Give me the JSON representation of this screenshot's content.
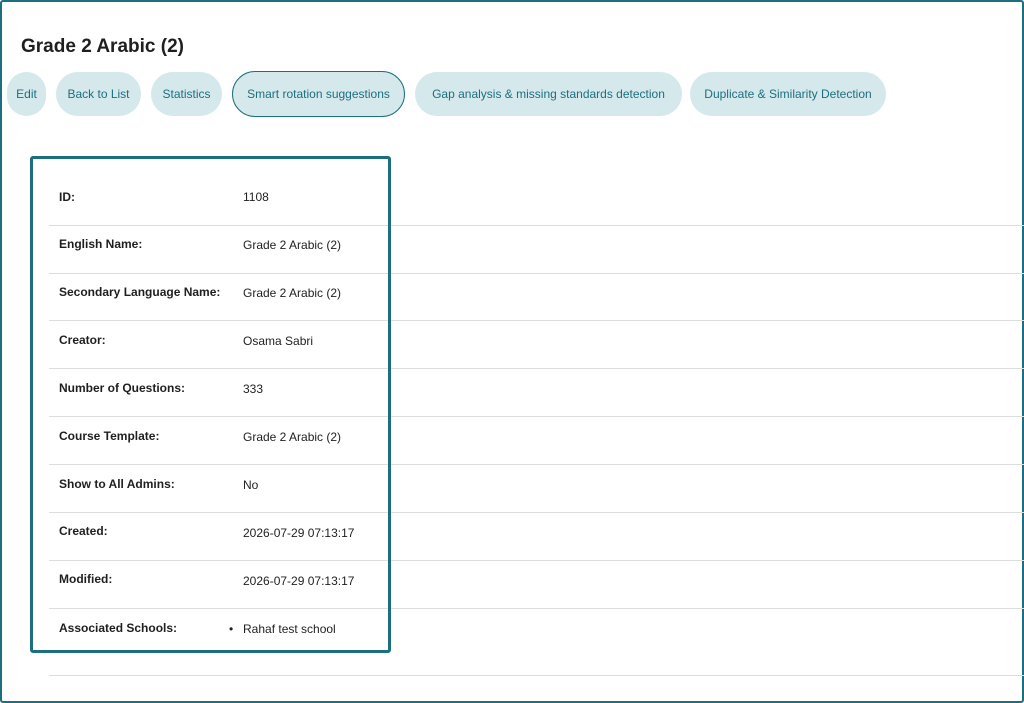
{
  "page": {
    "title": "Grade 2 Arabic (2)"
  },
  "actions": [
    {
      "label": "Edit"
    },
    {
      "label": "Back to List"
    },
    {
      "label": "Statistics"
    },
    {
      "label": "Smart rotation suggestions",
      "active": true
    },
    {
      "label": "Gap analysis & missing standards detection"
    },
    {
      "label": "Duplicate & Similarity Detection"
    }
  ],
  "details": {
    "rows": [
      {
        "label": "ID:",
        "value": "1108"
      },
      {
        "label": "English Name:",
        "value": "Grade 2 Arabic (2)"
      },
      {
        "label": "Secondary Language Name:",
        "value": "Grade 2 Arabic (2)"
      },
      {
        "label": "Creator:",
        "value": "Osama Sabri"
      },
      {
        "label": "Number of Questions:",
        "value": "333"
      },
      {
        "label": "Course Template:",
        "value": "Grade 2 Arabic (2)"
      },
      {
        "label": "Show to All Admins:",
        "value": "No"
      },
      {
        "label": "Created:",
        "value": "2026-07-29 07:13:17"
      },
      {
        "label": "Modified:",
        "value": "2026-07-29 07:13:17"
      }
    ],
    "schools_label": "Associated Schools:",
    "schools": [
      "Rahaf test school"
    ]
  },
  "colors": {
    "accent": "#1d6f7f",
    "button_bg": "#d5e8ec",
    "rule": "#dddddd"
  }
}
